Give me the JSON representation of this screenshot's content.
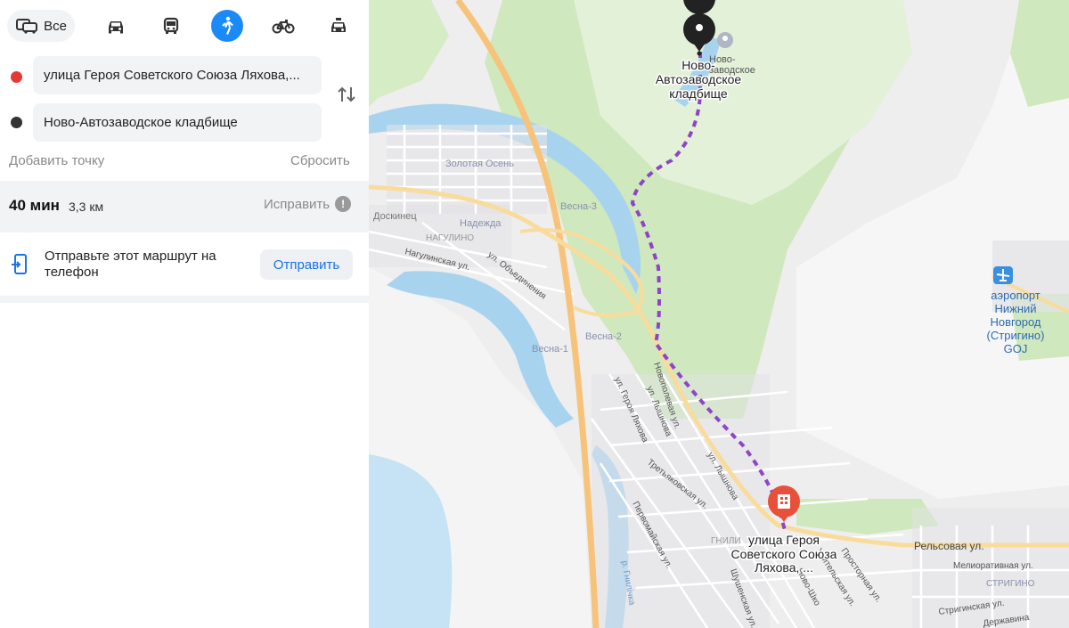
{
  "modes": {
    "all_label": "Все",
    "items": [
      {
        "name": "car-icon"
      },
      {
        "name": "bus-icon"
      },
      {
        "name": "walk-icon",
        "active": true
      },
      {
        "name": "bike-icon"
      },
      {
        "name": "taxi-icon"
      }
    ],
    "active_color": "#1a8af8"
  },
  "route": {
    "from": "улица Героя Советского Союза Ляхова,...",
    "to": "Ново-Автозаводское кладбище",
    "from_color": "#e53935",
    "to_color": "#333333",
    "add_point": "Добавить точку",
    "reset": "Сбросить"
  },
  "summary": {
    "time": "40 мин",
    "distance": "3,3 км",
    "fix": "Исправить"
  },
  "send": {
    "text": "Отправьте этот маршрут на телефон",
    "button": "Отправить"
  },
  "map": {
    "route_color": "#8e44c9",
    "labels": {
      "dest": "Ново-Автозаводское кладбище",
      "dest_l1": "Ново-",
      "dest_l2": "Автозаводское",
      "dest_l3": "кладбище",
      "dest_poi_l1": "Ново-",
      "dest_poi_l2": "заводское",
      "origin_l1": "улица Героя",
      "origin_l2": "Советского Союза",
      "origin_l3": "Ляхова, ...",
      "airport_l1": "аэропорт",
      "airport_l2": "Нижний",
      "airport_l3": "Новгород",
      "airport_l4": "(Стригино)",
      "airport_l5": "GOJ",
      "zolotaya": "Золотая Осень",
      "doskinets": "Доскинец",
      "nadezhda": "Надежда",
      "nagulino": "НАГУЛИНО",
      "vesna3": "Весна-3",
      "vesna2": "Весна-2",
      "vesna1": "Весна-1",
      "nagulinskaya": "Нагулинская ул.",
      "obedineniya": "ул. Объединения",
      "novopolevaya": "Новополевая ул.",
      "lyashova1": "ул. Лышнова",
      "lyashova2": "ул. Лышнова",
      "geroya": "ул. Героя Ляхова",
      "tretyakovskaya": "Третьяковская ул.",
      "pervomayskaya": "Первомайская ул.",
      "gnilichka": "р. Гнилічка",
      "gnili": "ГНИЛИ",
      "shushenskaya": "Шушенская ул.",
      "uchitelskaya": "Учительская ул.",
      "prostornaya": "Просторная ул.",
      "novo_sh": "Ново-Шко",
      "relsovaya": "Рельсовая ул.",
      "meliorativnaya": "Мелиоративная ул.",
      "strigino": "СТРИГИНО",
      "striginskaya": "Стригинская ул.",
      "derzhavina": "Державина"
    }
  }
}
